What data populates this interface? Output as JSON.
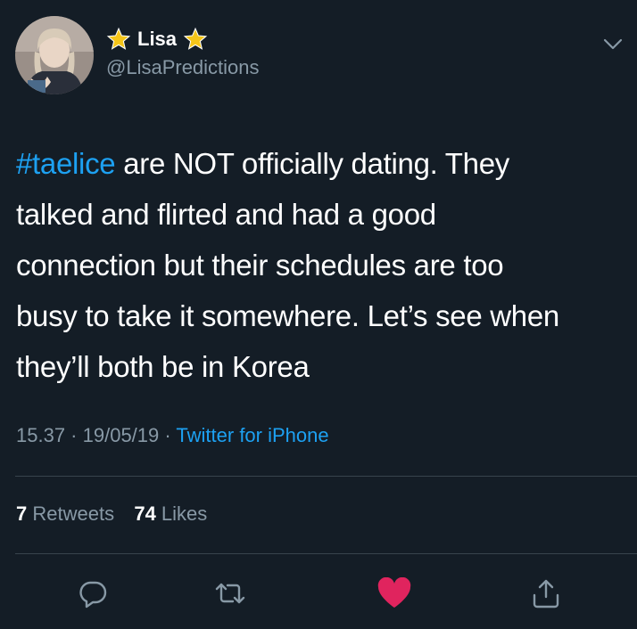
{
  "author": {
    "name": "Lisa",
    "handle": "@LisaPredictions",
    "badge_icon": "star-icon"
  },
  "tweet": {
    "hashtag": "#taelice",
    "lines": [
      " are NOT officially dating. They",
      "talked and flirted and had a good",
      "connection but their schedules are too",
      "busy to take it somewhere. Let’s see when",
      "they’ll both be in Korea"
    ]
  },
  "meta": {
    "time": "15.37",
    "separator": " · ",
    "date": "19/05/19",
    "source": "Twitter for iPhone"
  },
  "stats": {
    "retweets_count": "7",
    "retweets_label": " Retweets",
    "likes_count": "74",
    "likes_label": " Likes"
  },
  "actions": [
    "reply-icon",
    "retweet-icon",
    "like-heart-icon",
    "share-icon"
  ],
  "colors": {
    "background": "#141d26",
    "accent": "#1da1f2",
    "muted": "#8899a6",
    "like": "#e0245e",
    "star": "#f5c518"
  }
}
